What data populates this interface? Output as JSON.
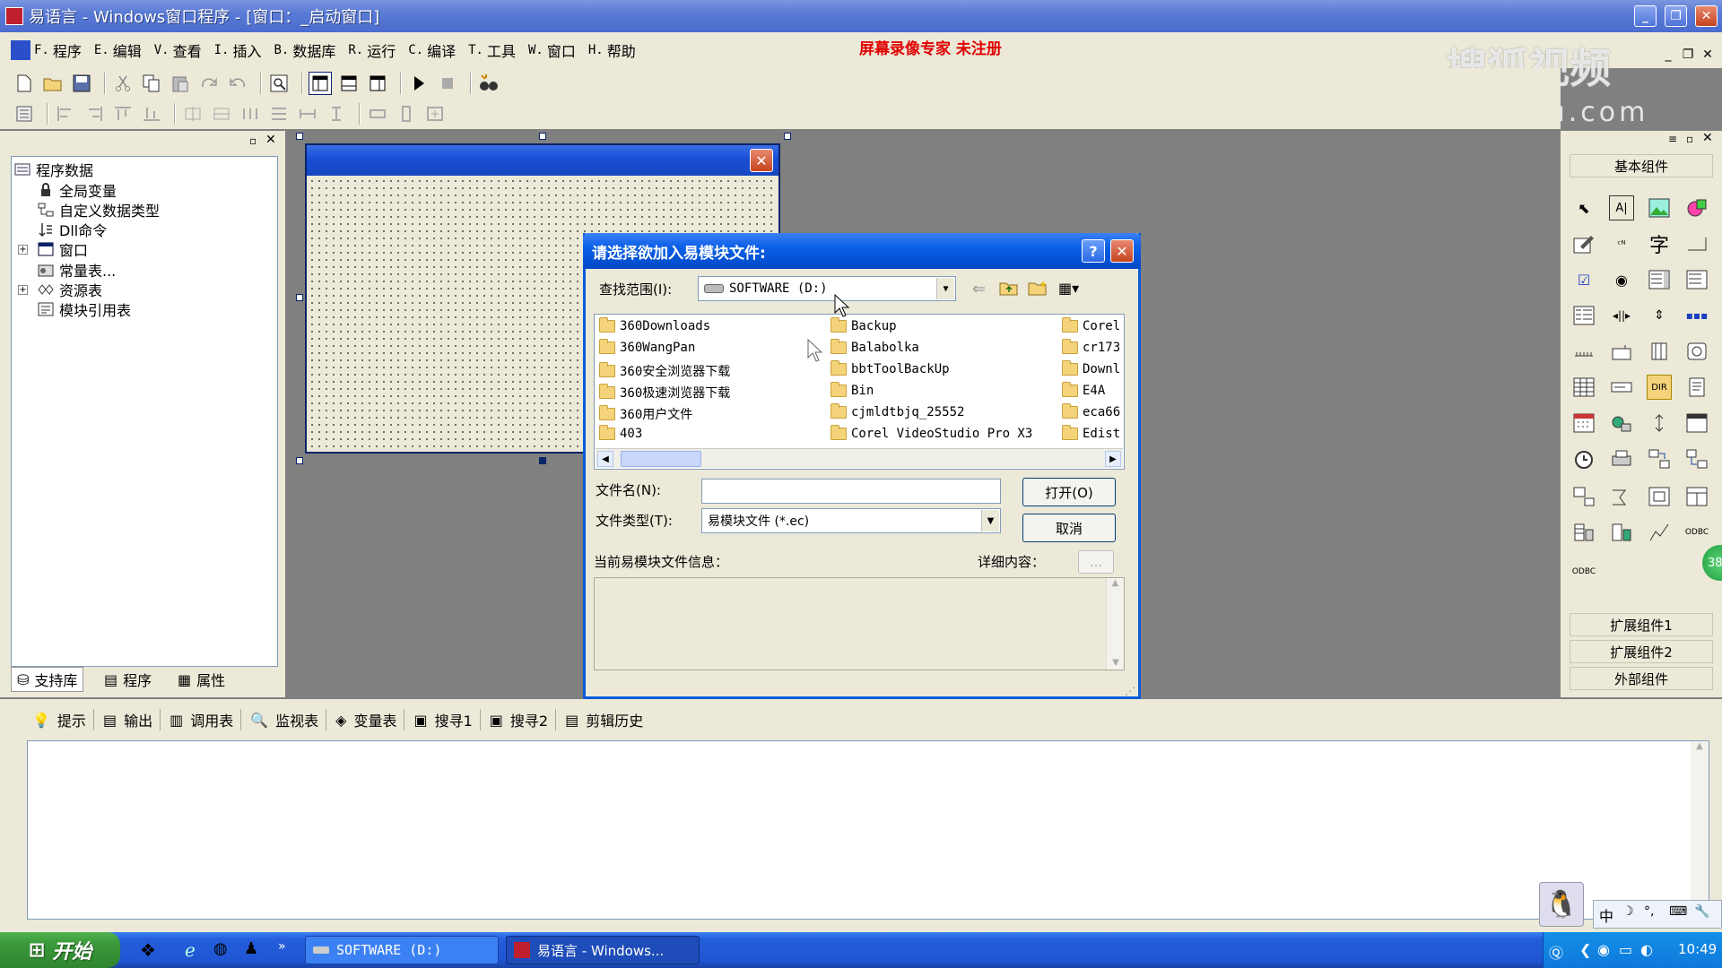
{
  "window": {
    "title": "易语言 - Windows窗口程序 - [窗口：_启动窗口]"
  },
  "menu": [
    {
      "key": "F.",
      "label": "程序"
    },
    {
      "key": "E.",
      "label": "编辑"
    },
    {
      "key": "V.",
      "label": "查看"
    },
    {
      "key": "I.",
      "label": "插入"
    },
    {
      "key": "B.",
      "label": "数据库"
    },
    {
      "key": "R.",
      "label": "运行"
    },
    {
      "key": "C.",
      "label": "编译"
    },
    {
      "key": "T.",
      "label": "工具"
    },
    {
      "key": "W.",
      "label": "窗口"
    },
    {
      "key": "H.",
      "label": "帮助"
    }
  ],
  "overlay": {
    "registration": "屏幕录像专家  未注册",
    "watermark_top": "搜狐视频",
    "watermark_url": "tv.sohu.com"
  },
  "tree": {
    "root": "程序数据",
    "items": [
      "全局变量",
      "自定义数据类型",
      "Dll命令",
      "窗口",
      "常量表...",
      "资源表",
      "模块引用表"
    ]
  },
  "left_tabs": [
    "支持库",
    "程序",
    "属性"
  ],
  "dialog": {
    "title": "请选择欲加入易模块文件:",
    "look_in_label": "查找范围(I):",
    "look_in_value": "SOFTWARE (D:)",
    "files_col1": [
      "360Downloads",
      "360WangPan",
      "360安全浏览器下载",
      "360极速浏览器下载",
      "360用户文件",
      "403"
    ],
    "files_col2": [
      "Backup",
      "Balabolka",
      "bbtToolBackUp",
      "Bin",
      "cjmldtbjq_25552",
      "Corel VideoStudio Pro X3"
    ],
    "files_col3": [
      "Corel",
      "cr173",
      "Downl",
      "E4A",
      "eca66",
      "Edist"
    ],
    "filename_label": "文件名(N):",
    "filename_value": "",
    "filetype_label": "文件类型(T):",
    "filetype_value": "易模块文件 (*.ec)",
    "open_button": "打开(O)",
    "cancel_button": "取消",
    "info_label": "当前易模块文件信息：",
    "detail_label": "详细内容：",
    "detail_button": "..."
  },
  "right_panel": {
    "header": "基本组件",
    "ext1": "扩展组件1",
    "ext2": "扩展组件2",
    "external": "外部组件"
  },
  "output_tabs": [
    "提示",
    "输出",
    "调用表",
    "监视表",
    "变量表",
    "搜寻1",
    "搜寻2",
    "剪辑历史"
  ],
  "taskbar": {
    "start": "开始",
    "task1": "SOFTWARE (D:)",
    "task2": "易语言 - Windows...",
    "clock": "10:49",
    "ime": "中"
  },
  "colors": {
    "titlebar": "#4b6ccf",
    "dialog_title": "#0a5fe6",
    "registration_text": "#e00000",
    "taskbar": "#245edb"
  }
}
